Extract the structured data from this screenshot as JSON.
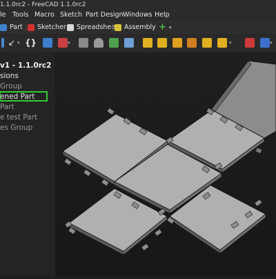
{
  "window": {
    "title": "1.1.0rc2 - FreeCAD 1.1.0rc2"
  },
  "menu": {
    "items": [
      "le",
      "Tools",
      "Macro",
      "Sketch",
      "Part Design",
      "Windows",
      "Help"
    ]
  },
  "workbenches": {
    "part": "Part",
    "sketcher": "Sketcher",
    "spreadsheet": "Spreadsheet",
    "assembly": "Assembly"
  },
  "tree": {
    "root": "v1 - 1.1.0rc2",
    "items": [
      {
        "label": "sions",
        "style": "normal"
      },
      {
        "label": "Group",
        "style": "dim"
      },
      {
        "label": "ened Part",
        "style": "selected"
      },
      {
        "label": "Part",
        "style": "dim"
      },
      {
        "label": "e test Part",
        "style": "dim"
      },
      {
        "label": "es Group",
        "style": "dim"
      }
    ]
  },
  "colors": {
    "selection_outline": "#33cc33",
    "panel_top": "#a9a9a9",
    "background": "#1b1b1b"
  }
}
